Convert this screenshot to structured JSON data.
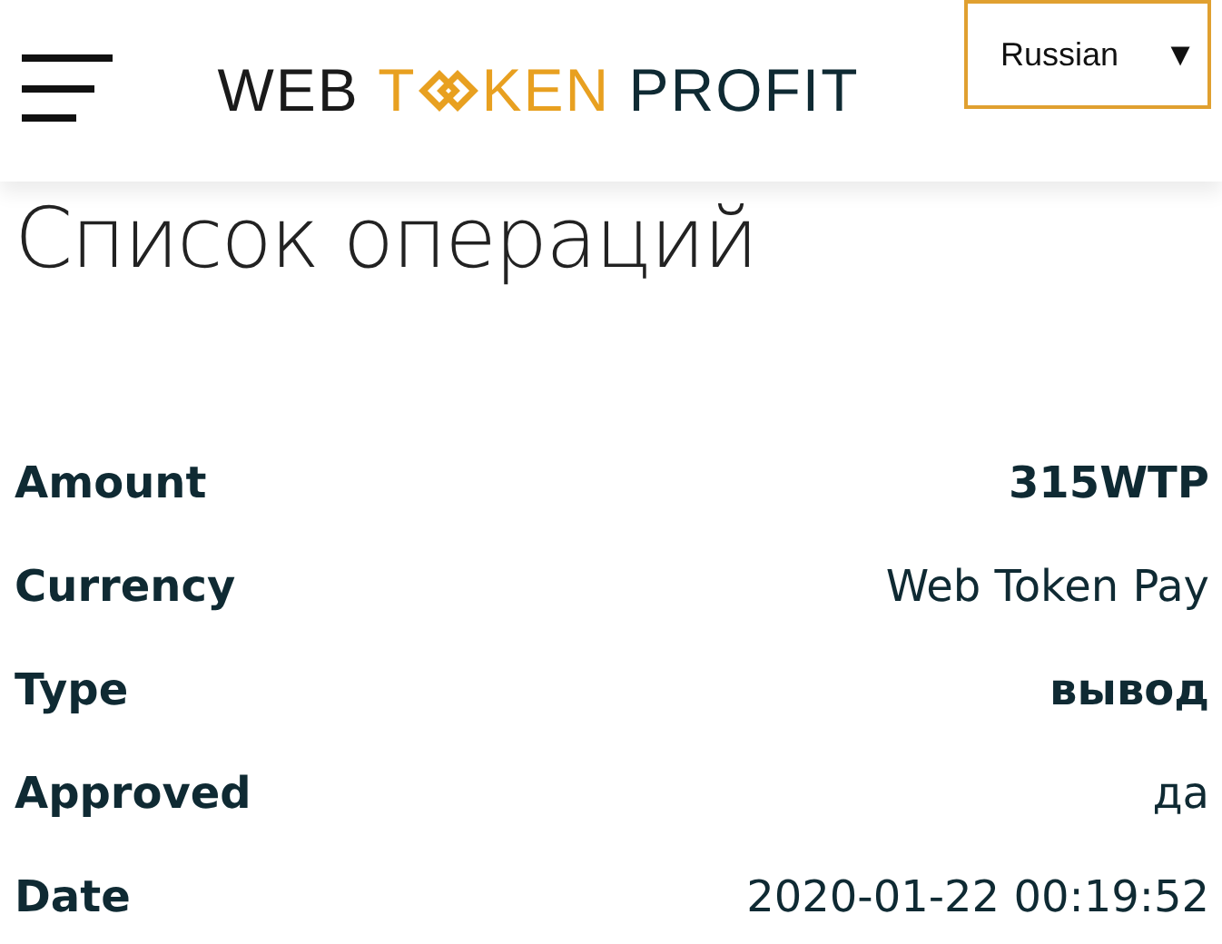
{
  "header": {
    "logo": {
      "lead": "WEB",
      "accent_before": "T",
      "accent_after": "KEN",
      "tail": "PROFIT"
    },
    "language": {
      "value": "Russian",
      "caret": "▼"
    }
  },
  "title": "Список операций",
  "details": [
    {
      "label": "Amount",
      "value": "315WTP",
      "emphasis": true
    },
    {
      "label": "Currency",
      "value": "Web Token Pay",
      "emphasis": false
    },
    {
      "label": "Type",
      "value": "вывод",
      "emphasis": true
    },
    {
      "label": "Approved",
      "value": "да",
      "emphasis": false
    },
    {
      "label": "Date",
      "value": "2020-01-22 00:19:52",
      "emphasis": false
    }
  ]
}
